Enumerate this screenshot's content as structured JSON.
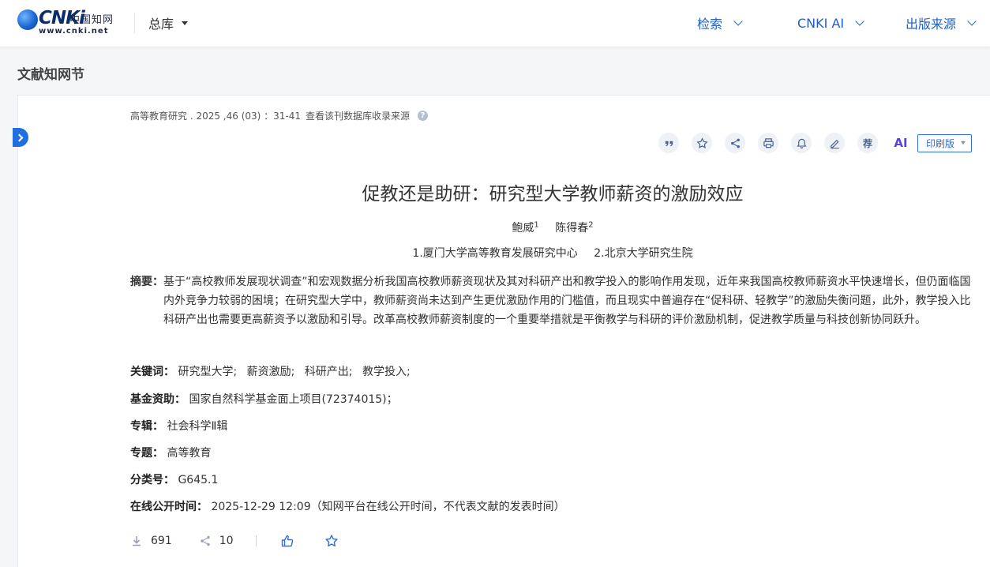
{
  "header": {
    "logo": {
      "word": "CNKi",
      "cn": "中国知网",
      "url": "www.cnki.net"
    },
    "library_select": "总库",
    "nav": [
      {
        "label": "检索"
      },
      {
        "label": "CNKI AI"
      },
      {
        "label": "出版来源"
      }
    ]
  },
  "section_title": "文献知网节",
  "article": {
    "source": "高等教育研究 . 2025 ,46 (03) ：31-41",
    "source_link": "查看该刊数据库收录来源",
    "toolbar": {
      "recommend_label": "荐",
      "ai_label": "AI",
      "print_label": "印刷版"
    },
    "title": "促教还是助研：研究型大学教师薪资的激励效应",
    "authors": [
      {
        "name": "鲍威",
        "sup": "1"
      },
      {
        "name": "陈得春",
        "sup": "2"
      }
    ],
    "affiliations": [
      "1.厦门大学高等教育发展研究中心",
      "2.北京大学研究生院"
    ],
    "abstract_label": "摘要：",
    "abstract": "基于“高校教师发展现状调查”和宏观数据分析我国高校教师薪资现状及其对科研产出和教学投入的影响作用发现，近年来我国高校教师薪资水平快速增长，但仍面临国内外竞争力较弱的困境；在研究型大学中，教师薪资尚未达到产生更优激励作用的门槛值，而且现实中普遍存在“促科研、轻教学”的激励失衡问题，此外，教学投入比科研产出也需要更高薪资予以激励和引导。改革高校教师薪资制度的一个重要举措就是平衡教学与科研的评价激励机制，促进教学质量与科技创新协同跃升。",
    "keywords_label": "关键词：",
    "keywords": [
      "研究型大学;",
      "薪资激励;",
      "科研产出;",
      "教学投入;"
    ],
    "fund_label": "基金资助：",
    "fund": "国家自然科学基金面上项目(72374015)；",
    "series_label": "专辑：",
    "series": "社会科学Ⅱ辑",
    "topic_label": "专题：",
    "topic": "高等教育",
    "class_label": "分类号：",
    "class_no": "G645.1",
    "online_label": "在线公开时间：",
    "online": "2025-12-29 12:09（知网平台在线公开时间，不代表文献的发表时间）",
    "downloads": "691",
    "shares": "10"
  }
}
